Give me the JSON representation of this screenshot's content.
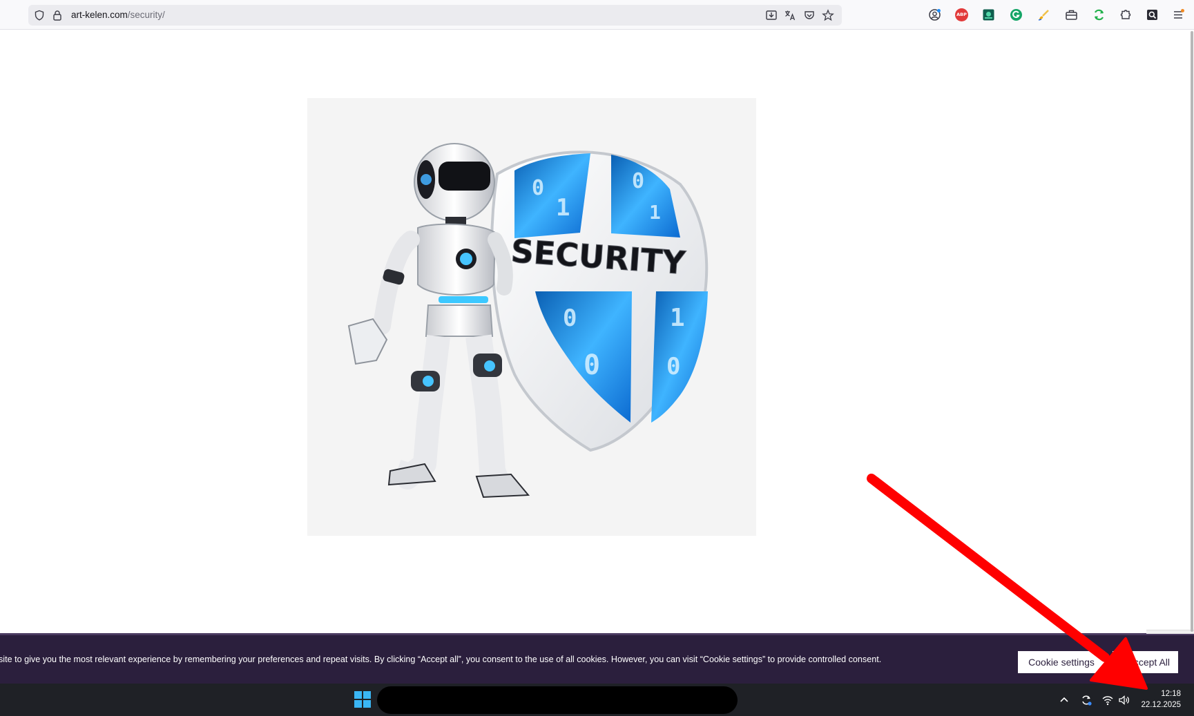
{
  "browser": {
    "url_domain": "art-kelen.com",
    "url_path": "/security/",
    "extensions": [
      "account-icon",
      "adblock-plus-icon",
      "green-ext-icon",
      "grammarly-icon",
      "brush-ext-icon",
      "toolbox-icon",
      "refresh-ext-icon",
      "puzzle-extensions-icon",
      "search-ext-icon",
      "menu-icon"
    ],
    "adblock_label": "ABP"
  },
  "page": {
    "hero_text": "SECURITY",
    "binary_digits": [
      "0",
      "1",
      "0",
      "1",
      "0",
      "0",
      "1",
      "0"
    ]
  },
  "cookie_banner": {
    "text": "site to give you the most relevant experience by remembering your preferences and repeat visits. By clicking “Accept all”, you consent to the use of all cookies. However, you can visit “Cookie settings” to provide controlled consent.",
    "settings_label": "Cookie settings",
    "accept_label": "ccept All"
  },
  "taskbar": {
    "time": "12:18",
    "date": "22.12.2025"
  },
  "colors": {
    "cookie_bg": "#2b1f3d",
    "taskbar_bg": "#1f2126",
    "annotation_arrow": "#ff0000",
    "shield_blue": "#1e8fe0"
  }
}
